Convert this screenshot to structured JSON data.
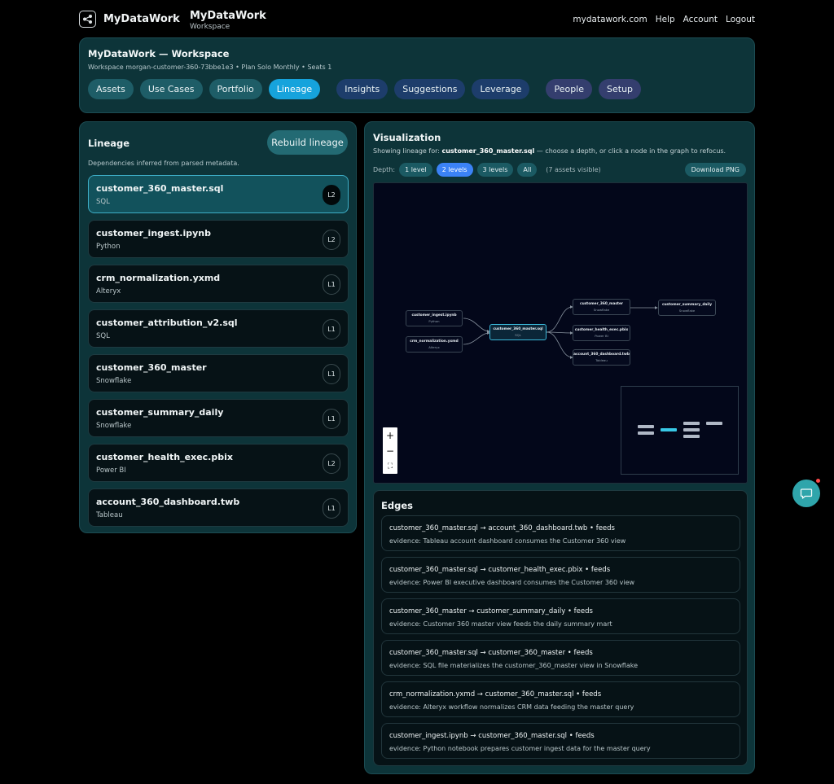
{
  "topbar": {
    "brand": "MyDataWork",
    "title": "MyDataWork",
    "subtitle": "Workspace",
    "nav": [
      "mydatawork.com",
      "Help",
      "Account",
      "Logout"
    ]
  },
  "workspace": {
    "title": "MyDataWork — Workspace",
    "subtitle": "Workspace morgan-customer-360-73bbe1e3 • Plan Solo Monthly • Seats 1",
    "tabs": [
      "Assets",
      "Use Cases",
      "Portfolio",
      "Lineage",
      "Insights",
      "Suggestions",
      "Leverage",
      "People",
      "Setup"
    ],
    "active_tab": "Lineage"
  },
  "lineage": {
    "title": "Lineage",
    "rebuild_label": "Rebuild lineage",
    "description": "Dependencies inferred from parsed metadata.",
    "assets": [
      {
        "name": "customer_360_master.sql",
        "type": "SQL",
        "level": "L2"
      },
      {
        "name": "customer_ingest.ipynb",
        "type": "Python",
        "level": "L2"
      },
      {
        "name": "crm_normalization.yxmd",
        "type": "Alteryx",
        "level": "L1"
      },
      {
        "name": "customer_attribution_v2.sql",
        "type": "SQL",
        "level": "L1"
      },
      {
        "name": "customer_360_master",
        "type": "Snowflake",
        "level": "L1"
      },
      {
        "name": "customer_summary_daily",
        "type": "Snowflake",
        "level": "L1"
      },
      {
        "name": "customer_health_exec.pbix",
        "type": "Power BI",
        "level": "L2"
      },
      {
        "name": "account_360_dashboard.twb",
        "type": "Tableau",
        "level": "L1"
      }
    ],
    "selected_index": 0
  },
  "visualization": {
    "title": "Visualization",
    "sub_prefix": "Showing lineage for:",
    "sub_asset": "customer_360_master.sql",
    "sub_suffix": "— choose a depth, or click a node in the graph to refocus.",
    "depth_label": "Depth:",
    "depth_options": [
      "1 level",
      "2 levels",
      "3 levels",
      "All"
    ],
    "active_depth": "2 levels",
    "visible_count": "(7 assets visible)",
    "download_label": "Download PNG",
    "zoom_controls": [
      "+",
      "−",
      "⛶"
    ],
    "graph_nodes": [
      {
        "name": "customer_ingest.ipynb",
        "type": "Python"
      },
      {
        "name": "crm_normalization.yxmd",
        "type": "Alteryx"
      },
      {
        "name": "customer_360_master.sql",
        "type": "SQL"
      },
      {
        "name": "customer_360_master",
        "type": "Snowflake"
      },
      {
        "name": "customer_health_exec.pbix",
        "type": "Power BI"
      },
      {
        "name": "account_360_dashboard.twb",
        "type": "Tableau"
      },
      {
        "name": "customer_summary_daily",
        "type": "Snowflake"
      }
    ]
  },
  "edges": {
    "title": "Edges",
    "items": [
      {
        "relation": "customer_360_master.sql → account_360_dashboard.twb • feeds",
        "evidence": "evidence: Tableau account dashboard consumes the Customer 360 view"
      },
      {
        "relation": "customer_360_master.sql → customer_health_exec.pbix • feeds",
        "evidence": "evidence: Power BI executive dashboard consumes the Customer 360 view"
      },
      {
        "relation": "customer_360_master → customer_summary_daily • feeds",
        "evidence": "evidence: Customer 360 master view feeds the daily summary mart"
      },
      {
        "relation": "customer_360_master.sql → customer_360_master • feeds",
        "evidence": "evidence: SQL file materializes the customer_360_master view in Snowflake"
      },
      {
        "relation": "crm_normalization.yxmd → customer_360_master.sql • feeds",
        "evidence": "evidence: Alteryx workflow normalizes CRM data feeding the master query"
      },
      {
        "relation": "customer_ingest.ipynb → customer_360_master.sql • feeds",
        "evidence": "evidence: Python notebook prepares customer ingest data for the master query"
      }
    ]
  },
  "colors": {
    "accent": "#16a3dc",
    "panel": "#0d3439",
    "chat": "#2fa5ab"
  }
}
